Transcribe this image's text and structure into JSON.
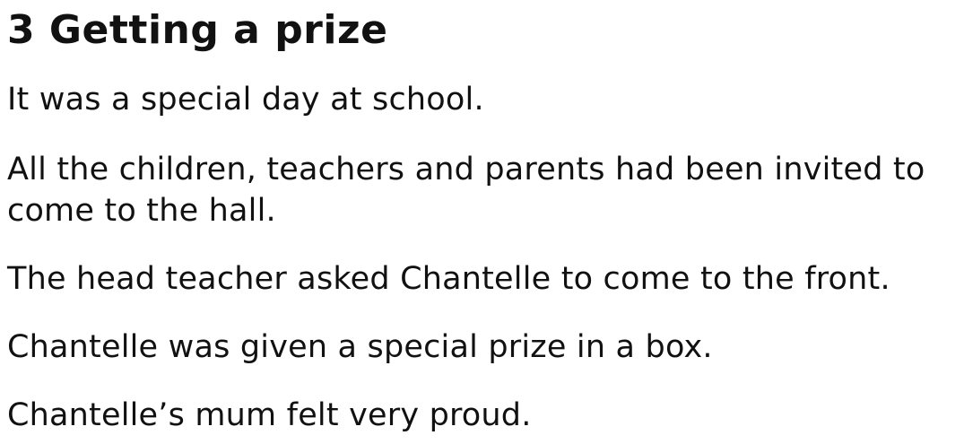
{
  "story": {
    "title": "3 Getting a prize",
    "paragraphs": [
      "It was a special day at school.",
      "All the children, teachers and parents had been invited to come to the hall.",
      "The head teacher asked Chantelle to come to the front.",
      "Chantelle was given a special prize in a box.",
      "Chantelle’s mum felt very proud."
    ]
  }
}
